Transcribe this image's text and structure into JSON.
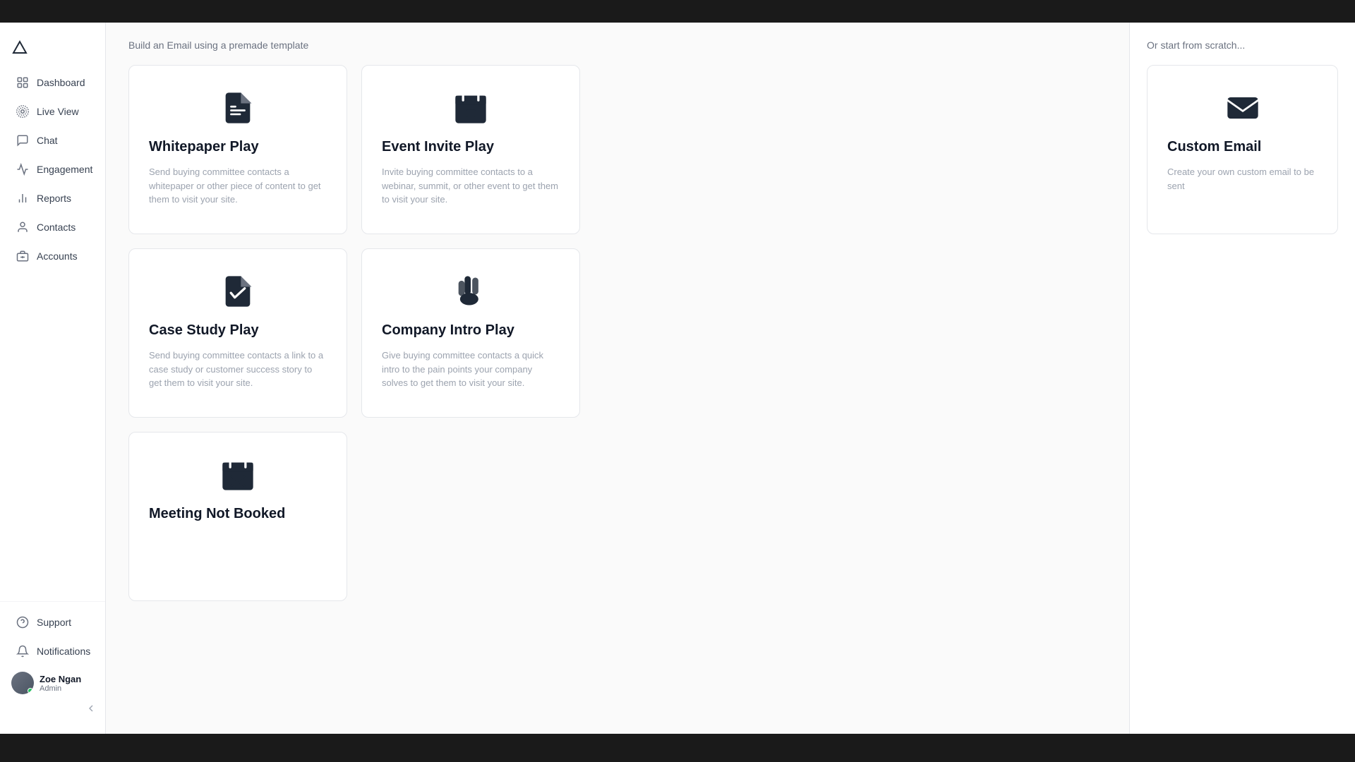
{
  "topbar": {},
  "sidebar": {
    "logo": "∧",
    "nav_items": [
      {
        "id": "dashboard",
        "label": "Dashboard",
        "icon": "dashboard-icon"
      },
      {
        "id": "live-view",
        "label": "Live View",
        "icon": "live-view-icon"
      },
      {
        "id": "chat",
        "label": "Chat",
        "icon": "chat-icon"
      },
      {
        "id": "engagement",
        "label": "Engagement",
        "icon": "engagement-icon"
      },
      {
        "id": "reports",
        "label": "Reports",
        "icon": "reports-icon"
      },
      {
        "id": "contacts",
        "label": "Contacts",
        "icon": "contacts-icon"
      },
      {
        "id": "accounts",
        "label": "Accounts",
        "icon": "accounts-icon"
      }
    ],
    "bottom_items": [
      {
        "id": "support",
        "label": "Support",
        "icon": "support-icon"
      },
      {
        "id": "notifications",
        "label": "Notifications",
        "icon": "notifications-icon"
      }
    ],
    "user": {
      "name": "Zoe Ngan",
      "role": "Admin"
    },
    "collapse_label": "‹"
  },
  "main": {
    "header": "Build an Email using a premade template",
    "cards": [
      {
        "id": "whitepaper-play",
        "title": "Whitepaper Play",
        "description": "Send buying committee contacts a whitepaper or other piece of content to get them to visit your site.",
        "icon": "document-icon"
      },
      {
        "id": "event-invite-play",
        "title": "Event Invite Play",
        "description": "Invite buying committee contacts to a webinar, summit, or other event to get them to visit your site.",
        "icon": "calendar-event-icon"
      },
      {
        "id": "case-study-play",
        "title": "Case Study Play",
        "description": "Send buying committee contacts a link to a case study or customer success story to get them to visit your site.",
        "icon": "document-check-icon"
      },
      {
        "id": "company-intro-play",
        "title": "Company Intro Play",
        "description": "Give buying committee contacts a quick intro to the pain points your company solves to get them to visit your site.",
        "icon": "wave-icon"
      },
      {
        "id": "meeting-not-booked",
        "title": "Meeting Not Booked",
        "description": "",
        "icon": "calendar-x-icon"
      }
    ]
  },
  "right_panel": {
    "header": "Or start from scratch...",
    "custom_email": {
      "title": "Custom Email",
      "description": "Create your own custom email to be sent",
      "icon": "email-icon"
    }
  }
}
